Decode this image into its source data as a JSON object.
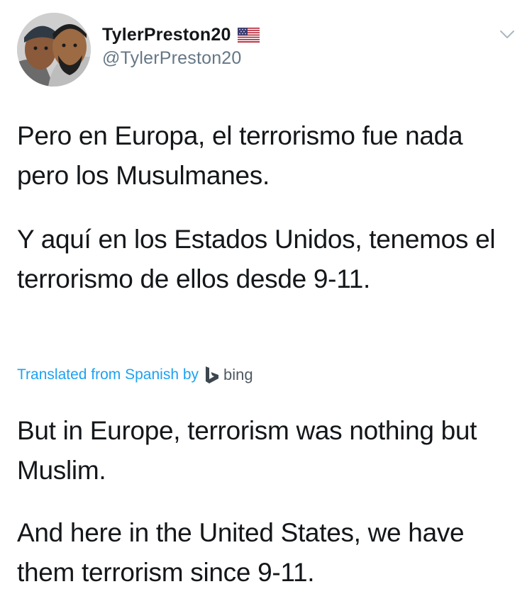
{
  "tweet": {
    "display_name": "TylerPreston20",
    "handle": "@TylerPreston20",
    "flag_icon": "us-flag-icon",
    "menu_icon": "chevron-down-icon",
    "original_paragraphs": [
      "Pero en Europa, el terrorismo fue nada pero los Musulmanes.",
      "Y aquí en los Estados Unidos, tenemos el terrorismo de ellos desde 9-11."
    ],
    "translation_label": "Translated from Spanish by",
    "translation_provider": "bing",
    "translated_paragraphs": [
      "But in Europe, terrorism was nothing but Muslim.",
      "And here in the United States, we have them terrorism since 9-11."
    ]
  },
  "colors": {
    "text": "#14171a",
    "handle": "#657786",
    "link": "#1da1f2"
  }
}
